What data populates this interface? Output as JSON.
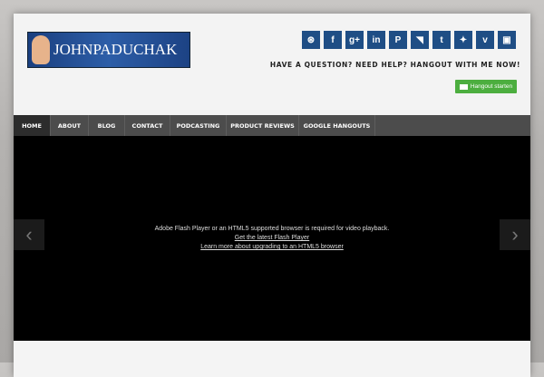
{
  "header": {
    "logo_text": "JOHNPADUCHAK",
    "tagline": "HAVE A QUESTION? NEED HELP? HANGOUT WITH ME NOW!",
    "hangout_button": "Hangout starten"
  },
  "social": [
    {
      "name": "dribbble",
      "glyph": "⊛"
    },
    {
      "name": "facebook",
      "glyph": "f"
    },
    {
      "name": "google-plus",
      "glyph": "g+"
    },
    {
      "name": "linkedin",
      "glyph": "in"
    },
    {
      "name": "pinterest",
      "glyph": "P"
    },
    {
      "name": "rss",
      "glyph": "◥"
    },
    {
      "name": "tumblr",
      "glyph": "t"
    },
    {
      "name": "twitter",
      "glyph": "✦"
    },
    {
      "name": "vimeo",
      "glyph": "v"
    },
    {
      "name": "youtube",
      "glyph": "▣"
    }
  ],
  "nav": [
    "HOME",
    "ABOUT",
    "BLOG",
    "CONTACT",
    "PODCASTING",
    "PRODUCT REVIEWS",
    "GOOGLE HANGOUTS"
  ],
  "video": {
    "message": "Adobe Flash Player or an HTML5 supported browser is required for video playback.",
    "link1": "Get the latest Flash Player",
    "link2": "Learn more about upgrading to an HTML5 browser",
    "prev": "‹",
    "next": "›"
  },
  "colors": {
    "social": "#1f4e85",
    "hangout": "#4cae3f",
    "nav": "#4c4c4c"
  }
}
